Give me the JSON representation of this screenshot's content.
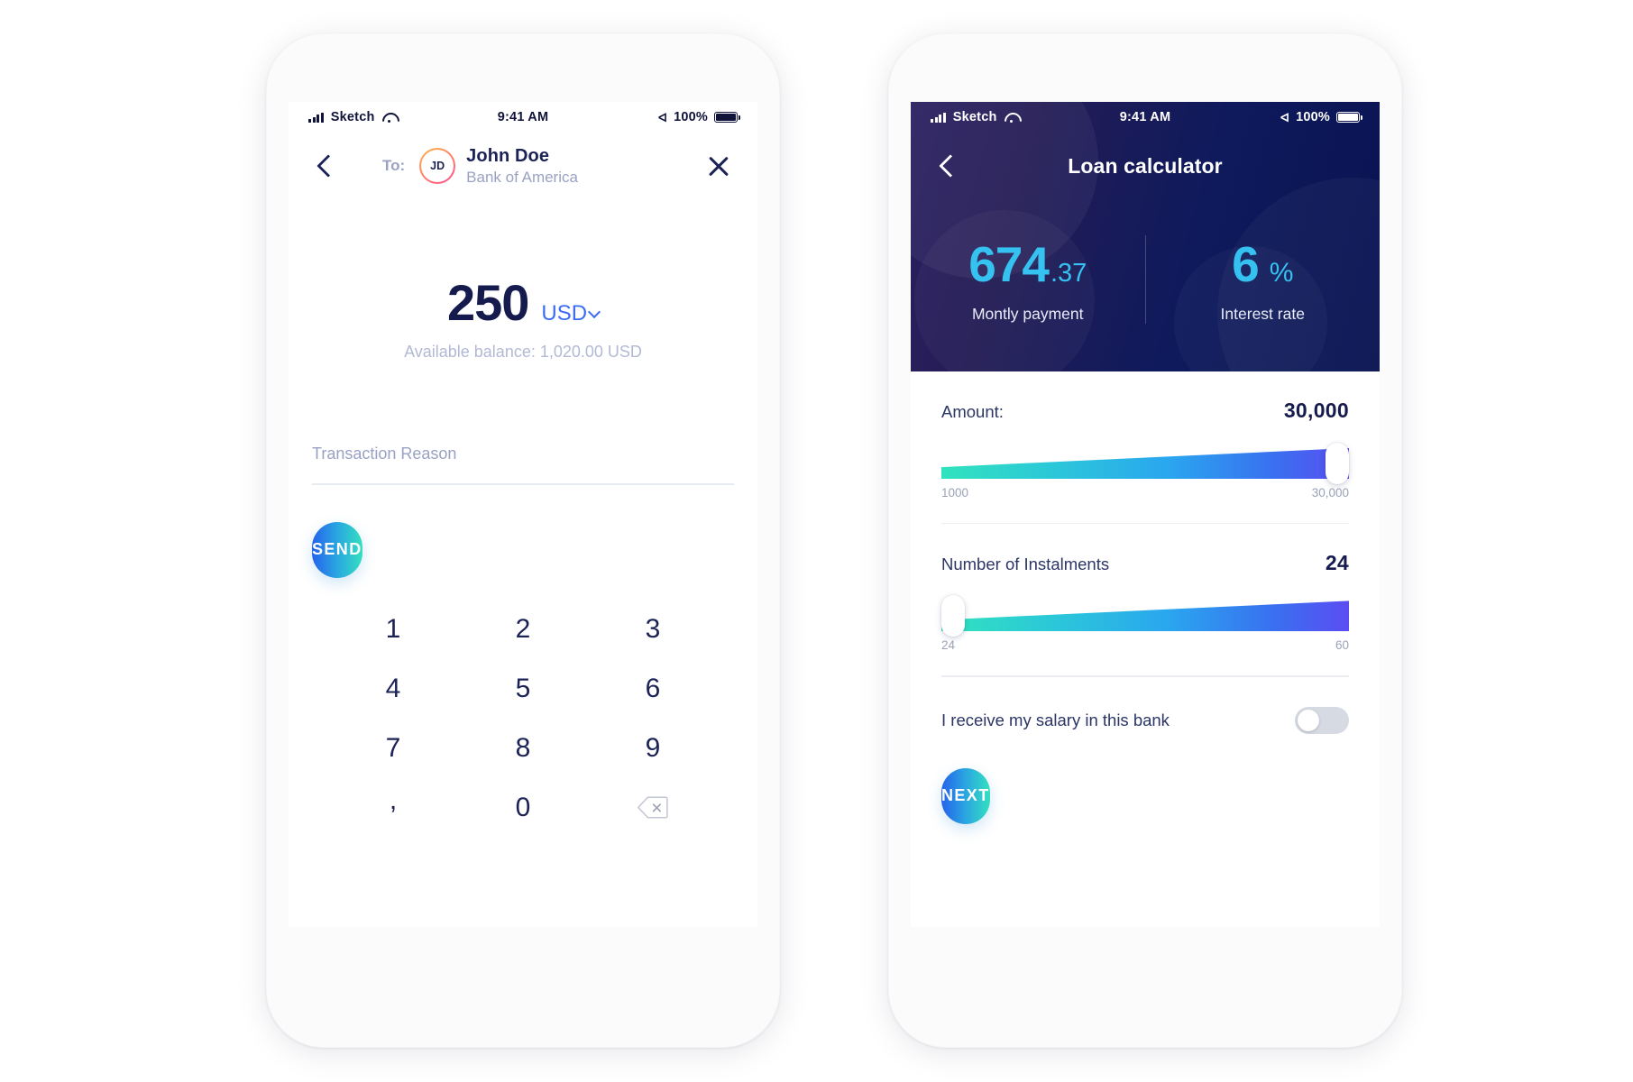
{
  "theme": {
    "accent_blue": "#3b6cf6",
    "navy": "#151c4d",
    "muted": "#9aa2c4",
    "cyan": "#35c2f0",
    "gradient_start": "#2563eb",
    "gradient_mid": "#2aa9e0",
    "gradient_end": "#34e0c0",
    "hero_dark": "#0e1a5c"
  },
  "status_bar": {
    "carrier": "Sketch",
    "time": "9:41 AM",
    "battery_percent": "100%",
    "signal_icon": "signal-bars-icon",
    "wifi_icon": "wifi-icon",
    "bluetooth_icon": "bluetooth-icon",
    "battery_icon": "battery-icon"
  },
  "send_screen": {
    "back_icon": "chevron-left-icon",
    "close_icon": "close-icon",
    "to_label": "To:",
    "avatar_initials": "JD",
    "recipient_name": "John Doe",
    "recipient_bank": "Bank of America",
    "amount": "250",
    "currency": "USD",
    "currency_chevron_icon": "chevron-down-icon",
    "balance_text": "Available balance: 1,020.00 USD",
    "reason_placeholder": "Transaction Reason",
    "reason_value": "",
    "send_label": "SEND",
    "keypad": [
      {
        "label": "1",
        "name": "key-1"
      },
      {
        "label": "2",
        "name": "key-2"
      },
      {
        "label": "3",
        "name": "key-3"
      },
      {
        "label": "4",
        "name": "key-4"
      },
      {
        "label": "5",
        "name": "key-5"
      },
      {
        "label": "6",
        "name": "key-6"
      },
      {
        "label": "7",
        "name": "key-7"
      },
      {
        "label": "8",
        "name": "key-8"
      },
      {
        "label": "9",
        "name": "key-9"
      },
      {
        "label": ",",
        "name": "key-comma"
      },
      {
        "label": "0",
        "name": "key-0"
      },
      {
        "label": "",
        "name": "key-backspace"
      }
    ]
  },
  "loan_screen": {
    "back_icon": "chevron-left-icon",
    "title": "Loan calculator",
    "stats": [
      {
        "whole": "674",
        "decimal": ".37",
        "suffix": "",
        "caption": "Montly payment"
      },
      {
        "whole": "6",
        "decimal": "",
        "suffix": "%",
        "caption": "Interest rate"
      }
    ],
    "amount_field": {
      "label": "Amount:",
      "value": "30,000",
      "min_label": "1000",
      "max_label": "30,000",
      "knob_position_percent": 100
    },
    "instalments_field": {
      "label": "Number of Instalments",
      "value": "24",
      "min_label": "24",
      "max_label": "60",
      "knob_position_percent": 0
    },
    "salary_toggle": {
      "label": "I receive my salary in this bank",
      "state": "off"
    },
    "next_label": "NEXT"
  }
}
